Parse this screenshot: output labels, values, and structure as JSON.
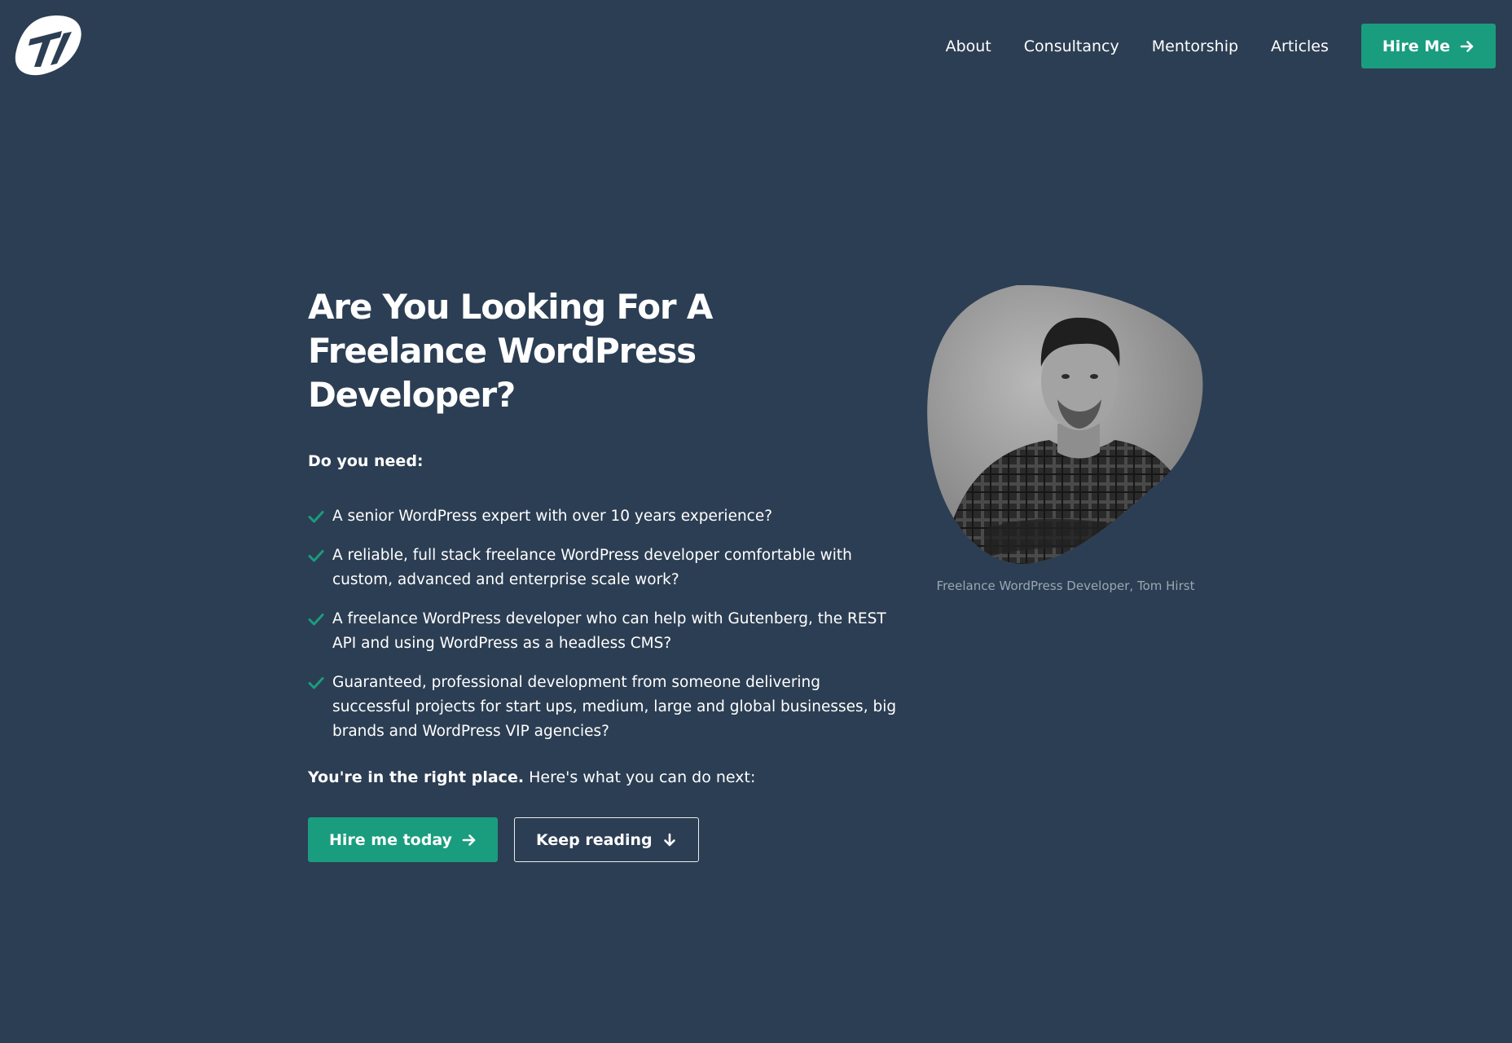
{
  "header": {
    "logo_alt": "Tom Hirst logo",
    "nav": [
      "About",
      "Consultancy",
      "Mentorship",
      "Articles"
    ],
    "cta_label": "Hire Me",
    "cta_icon": "arrow-right-icon"
  },
  "hero": {
    "title": "Are You Looking For A Freelance WordPress Developer?",
    "intro": "Do you need:",
    "checklist": [
      "A senior WordPress expert with over 10 years experience?",
      "A reliable, full stack freelance WordPress developer comfortable with custom, advanced and enterprise scale work?",
      "A freelance WordPress developer who can help with Gutenberg, the REST API and using WordPress as a headless CMS?",
      "Guaranteed, professional development from someone delivering successful projects for start ups, medium, large and global businesses, big brands and WordPress VIP agencies?"
    ],
    "next_strong": "You're in the right place.",
    "next_rest": " Here's what you can do next:",
    "buttons": {
      "primary": "Hire me today",
      "secondary": "Keep reading"
    }
  },
  "portrait": {
    "caption": "Freelance WordPress Developer, Tom Hirst"
  },
  "colors": {
    "background": "#2c3e53",
    "accent": "#1a9c7f",
    "text": "#ffffff",
    "caption": "#9aa6b3"
  }
}
